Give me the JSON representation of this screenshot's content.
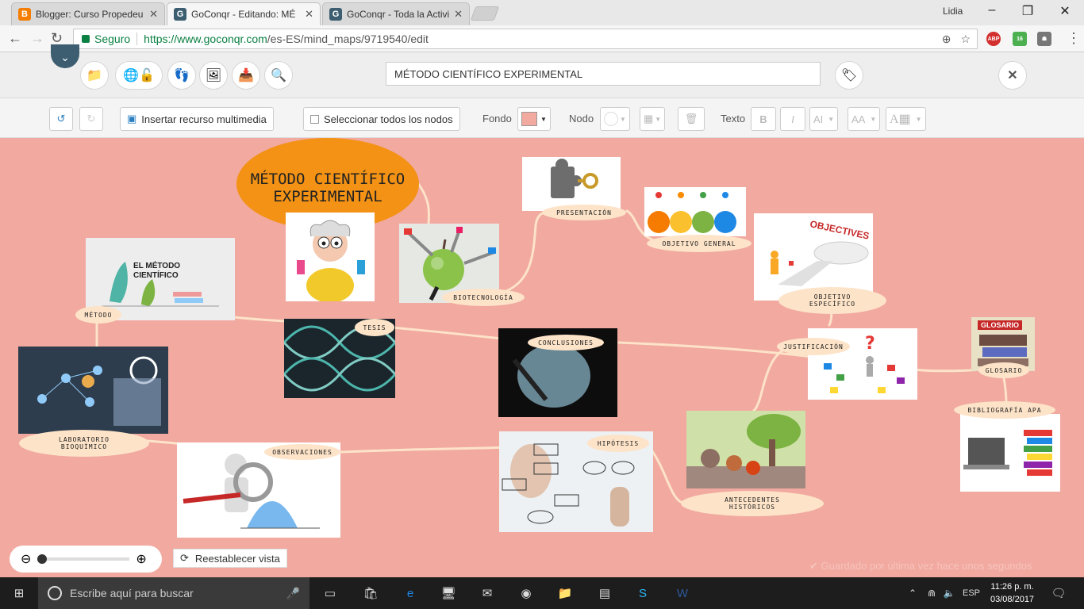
{
  "browser": {
    "tabs": [
      {
        "label": "Blogger: Curso Propedeu",
        "favicon": "blogger-icon",
        "color": "#f57d00"
      },
      {
        "label": "GoConqr - Editando: MÉ",
        "favicon": "goconqr-icon",
        "color": "#3c5e70"
      },
      {
        "label": "GoConqr - Toda la Activi",
        "favicon": "goconqr-icon",
        "color": "#3c5e70"
      }
    ],
    "user": "Lidia",
    "secure_label": "Seguro",
    "url_scheme_host": "https://www.goconqr.com",
    "url_path": "/es-ES/mind_maps/9719540/edit",
    "ext_badge": "16"
  },
  "editor": {
    "title_value": "MÉTODO CIENTÍFICO EXPERIMENTAL",
    "insert_media_label": "Insertar recurso multimedia",
    "select_all_label": "Seleccionar todos los nodos",
    "fondo_label": "Fondo",
    "nodo_label": "Nodo",
    "texto_label": "Texto",
    "background_color": "#f1a9a0"
  },
  "mindmap": {
    "central": "MÉTODO CIENTÍFICO EXPERIMENTAL",
    "nodes": {
      "presentacion": "PRESENTACIÓN",
      "objetivo_general": "OBJETIVO GENERAL",
      "objetivo_especifico": "OBJETIVO ESPECÍFICO",
      "biotecnologia": "BIOTECNOLOGÍA",
      "metodo": "MÉTODO",
      "tesis": "TESIS",
      "conclusiones": "CONCLUSIONES",
      "justificacion": "JUSTIFICACIÓN",
      "glosario": "GLOSARIO",
      "bibliografia": "BIBLIOGRAFÍA APA",
      "laboratorio": "LABORATORIO BIOQUÍMICO",
      "observaciones": "OBSERVACIONES",
      "hipotesis": "HIPÓTESIS",
      "antecedentes": "ANTECEDENTES HISTÓRICOS"
    },
    "image_texts": {
      "metodo_card": "EL MÉTODO CIENTÍFICO",
      "objectives": "OBJECTIVES",
      "glosario_book": "GLOSARIO"
    }
  },
  "footer": {
    "reset_label": "Reestablecer vista",
    "saved_label": "Guardado por última vez hace unos segundos"
  },
  "taskbar": {
    "search_placeholder": "Escribe aquí para buscar",
    "lang": "ESP",
    "time": "11:26 p. m.",
    "date": "03/08/2017"
  }
}
